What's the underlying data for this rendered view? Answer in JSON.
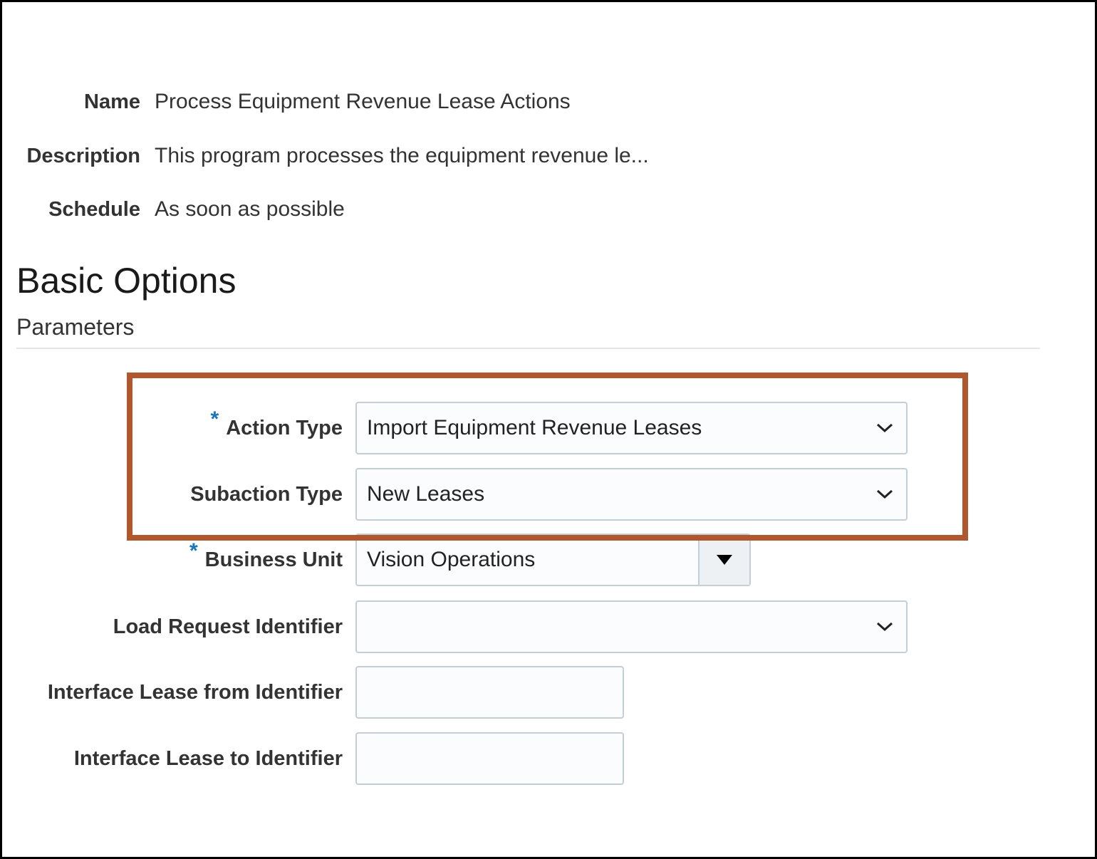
{
  "details": {
    "name_label": "Name",
    "name_value": "Process Equipment Revenue Lease Actions",
    "description_label": "Description",
    "description_value": "This program processes the equipment revenue le...",
    "schedule_label": "Schedule",
    "schedule_value": "As soon as possible"
  },
  "section": {
    "title": "Basic Options",
    "subtitle": "Parameters"
  },
  "params": {
    "action_type": {
      "label": "Action Type",
      "required": "*",
      "value": "Import Equipment Revenue Leases"
    },
    "subaction_type": {
      "label": "Subaction Type",
      "value": "New Leases"
    },
    "business_unit": {
      "label": "Business Unit",
      "required": "*",
      "value": "Vision Operations"
    },
    "load_request_identifier": {
      "label": "Load Request Identifier",
      "value": ""
    },
    "interface_lease_from": {
      "label": "Interface Lease from Identifier",
      "value": ""
    },
    "interface_lease_to": {
      "label": "Interface Lease to Identifier",
      "value": ""
    }
  },
  "colors": {
    "highlight_border": "#b0572e",
    "required_marker": "#1b75bb",
    "field_border": "#c4ced7"
  },
  "icons": {
    "select_chevron": "chevron-down-icon",
    "lov_dropdown": "triangle-down-icon"
  }
}
